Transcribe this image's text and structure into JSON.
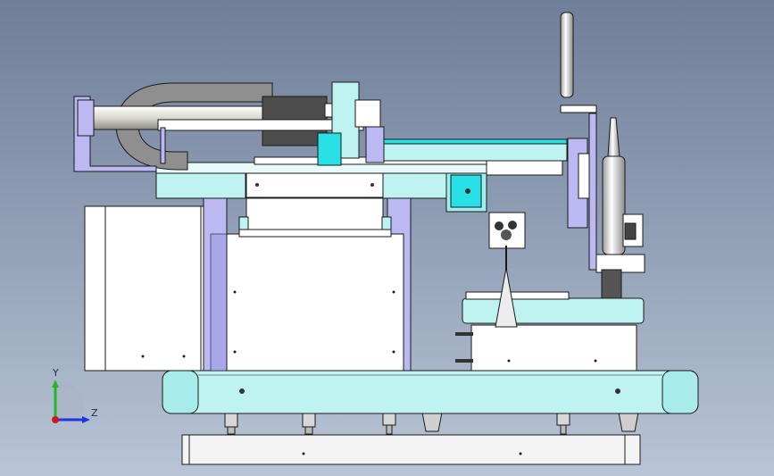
{
  "viewport": {
    "background_top": "#6f7f98",
    "background_bottom": "#b9c5d6"
  },
  "colors": {
    "cyan": "#b9f2f0",
    "cyan_dark": "#27e1e6",
    "violet": "#b9b6f0",
    "white": "#ffffff",
    "gray": "#d9d9d9",
    "dark_gray": "#4f4f4f",
    "outline": "#1a1a1a"
  },
  "triad": {
    "y_label": "Y",
    "z_label": "Z",
    "y_color": "#23b823",
    "z_color": "#1f36e0",
    "x_color": "#d01818"
  },
  "model": {
    "components": [
      "base-plate",
      "cyan-frame",
      "leveling-feet",
      "cabinet-left",
      "motor-box",
      "upper-slide",
      "cable-hook",
      "spindle-tower",
      "sensor-block",
      "workpiece-table",
      "cone-probe"
    ]
  }
}
